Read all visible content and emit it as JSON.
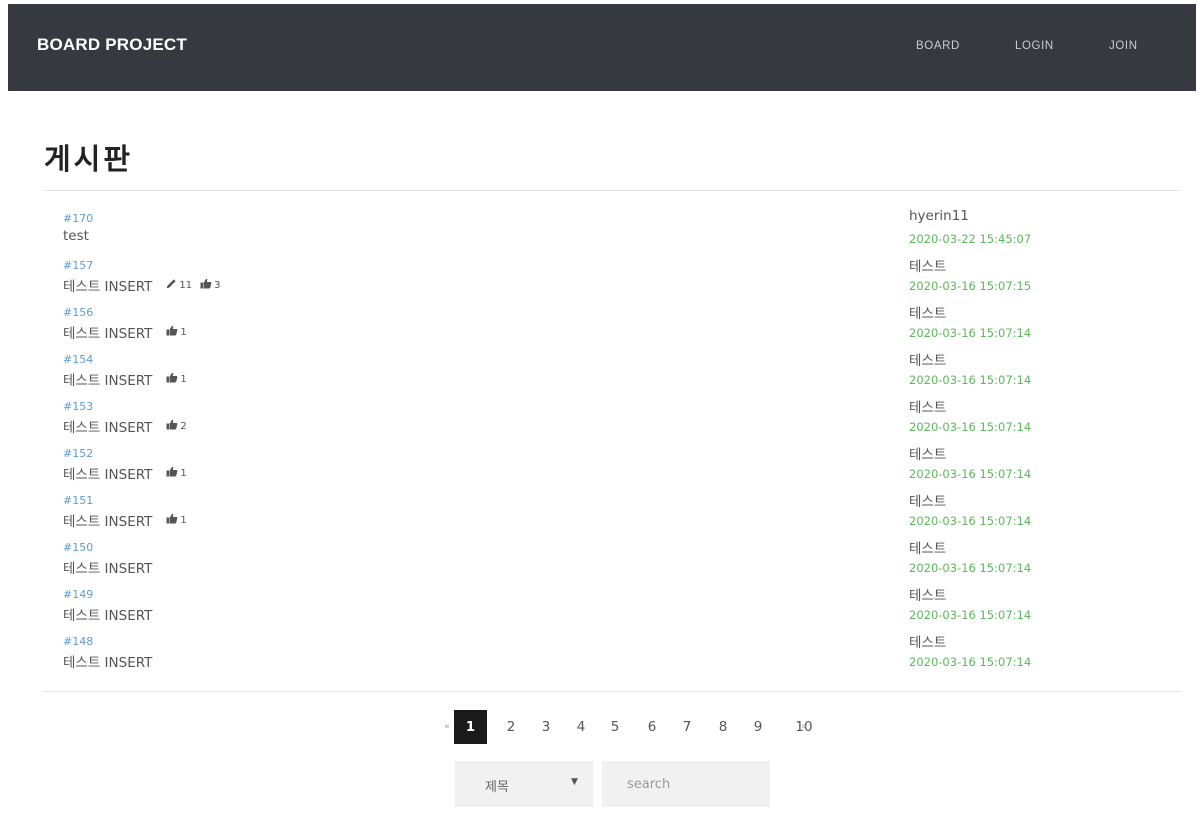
{
  "brand": "BOARD PROJECT",
  "nav": [
    {
      "label": "BOARD"
    },
    {
      "label": "LOGIN"
    },
    {
      "label": "JOIN"
    }
  ],
  "page_title": "게시판",
  "posts": [
    {
      "num": "#170",
      "title": "test",
      "author": "hyerin11",
      "date": "2020-03-22 15:45:07",
      "comments": null,
      "likes": null
    },
    {
      "num": "#157",
      "title": "테스트 INSERT",
      "author": "테스트",
      "date": "2020-03-16 15:07:15",
      "comments": "11",
      "likes": "3"
    },
    {
      "num": "#156",
      "title": "테스트 INSERT",
      "author": "테스트",
      "date": "2020-03-16 15:07:14",
      "comments": null,
      "likes": "1"
    },
    {
      "num": "#154",
      "title": "테스트 INSERT",
      "author": "테스트",
      "date": "2020-03-16 15:07:14",
      "comments": null,
      "likes": "1"
    },
    {
      "num": "#153",
      "title": "테스트 INSERT",
      "author": "테스트",
      "date": "2020-03-16 15:07:14",
      "comments": null,
      "likes": "2"
    },
    {
      "num": "#152",
      "title": "테스트 INSERT",
      "author": "테스트",
      "date": "2020-03-16 15:07:14",
      "comments": null,
      "likes": "1"
    },
    {
      "num": "#151",
      "title": "테스트 INSERT",
      "author": "테스트",
      "date": "2020-03-16 15:07:14",
      "comments": null,
      "likes": "1"
    },
    {
      "num": "#150",
      "title": "테스트 INSERT",
      "author": "테스트",
      "date": "2020-03-16 15:07:14",
      "comments": null,
      "likes": null
    },
    {
      "num": "#149",
      "title": "테스트 INSERT",
      "author": "테스트",
      "date": "2020-03-16 15:07:14",
      "comments": null,
      "likes": null
    },
    {
      "num": "#148",
      "title": "테스트 INSERT",
      "author": "테스트",
      "date": "2020-03-16 15:07:14",
      "comments": null,
      "likes": null
    }
  ],
  "pagination": {
    "prev": "«",
    "next": "»",
    "pages": [
      "1",
      "2",
      "3",
      "4",
      "5",
      "6",
      "7",
      "8",
      "9",
      "10"
    ],
    "current": "1"
  },
  "search": {
    "selected_option": "제목",
    "placeholder": "search"
  },
  "colors": {
    "navbar": "#363a40",
    "post_number": "#5d9bd4",
    "date": "#5cb85c",
    "active_page": "#1a1a1a"
  }
}
